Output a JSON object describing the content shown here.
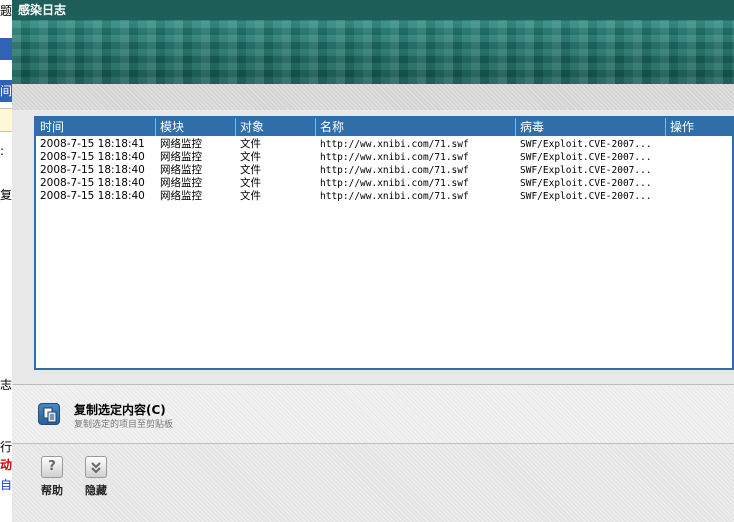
{
  "background_app": {
    "fragments": [
      "题",
      "间",
      ":",
      "复",
      "志",
      "行",
      "动",
      "自"
    ]
  },
  "window": {
    "title": "感染日志"
  },
  "list": {
    "columns": [
      "时间",
      "模块",
      "对象",
      "名称",
      "病毒",
      "操作"
    ],
    "rows": [
      {
        "time": "2008-7-15 18:18:41",
        "module": "网络监控",
        "object": "文件",
        "name": "http://ww.xnibi.com/71.swf",
        "virus": "SWF/Exploit.CVE-2007...",
        "action": ""
      },
      {
        "time": "2008-7-15 18:18:40",
        "module": "网络监控",
        "object": "文件",
        "name": "http://ww.xnibi.com/71.swf",
        "virus": "SWF/Exploit.CVE-2007...",
        "action": ""
      },
      {
        "time": "2008-7-15 18:18:40",
        "module": "网络监控",
        "object": "文件",
        "name": "http://ww.xnibi.com/71.swf",
        "virus": "SWF/Exploit.CVE-2007...",
        "action": ""
      },
      {
        "time": "2008-7-15 18:18:40",
        "module": "网络监控",
        "object": "文件",
        "name": "http://ww.xnibi.com/71.swf",
        "virus": "SWF/Exploit.CVE-2007...",
        "action": ""
      },
      {
        "time": "2008-7-15 18:18:40",
        "module": "网络监控",
        "object": "文件",
        "name": "http://ww.xnibi.com/71.swf",
        "virus": "SWF/Exploit.CVE-2007...",
        "action": ""
      }
    ]
  },
  "copy_action": {
    "title": "复制选定内容(C)",
    "subtitle": "复制选定的项目至剪贴板",
    "icon": "copy-icon"
  },
  "toolbar": {
    "help_label": "帮助",
    "help_icon": "help-icon",
    "hide_label": "隐藏",
    "hide_icon": "chevron-down-icon"
  },
  "colors": {
    "title_bar": "#1f5f5a",
    "header": "#2f6ea8",
    "banner": "#1d6e66"
  }
}
